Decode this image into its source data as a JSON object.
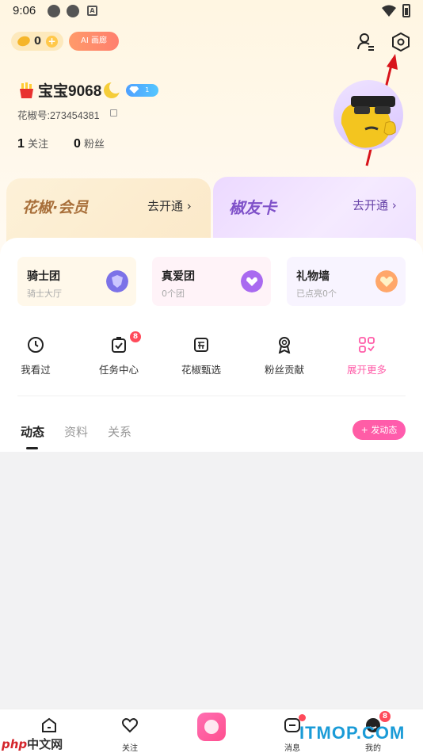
{
  "status_bar": {
    "time": "9:06"
  },
  "header": {
    "coin_count": "0",
    "ai_label": "AI 画廊"
  },
  "profile": {
    "name": "宝宝9068",
    "level": "1",
    "id_text": "花椒号:273454381",
    "following_count": "1",
    "following_label": "关注",
    "fans_count": "0",
    "fans_label": "粉丝"
  },
  "member_cards": [
    {
      "title": "花椒·会员",
      "action": "去开通 ›"
    },
    {
      "title": "椒友卡",
      "action": "去开通 ›"
    }
  ],
  "fan_cards": [
    {
      "title": "骑士团",
      "subtitle": "骑士大厅"
    },
    {
      "title": "真爱团",
      "subtitle": "0个团"
    },
    {
      "title": "礼物墙",
      "subtitle": "已点亮0个"
    }
  ],
  "quick_actions": [
    {
      "label": "我看过",
      "icon": "clock-icon"
    },
    {
      "label": "任务中心",
      "icon": "task-icon",
      "badge": "8"
    },
    {
      "label": "花椒甄选",
      "icon": "store-icon"
    },
    {
      "label": "粉丝贡献",
      "icon": "medal-icon"
    },
    {
      "label": "展开更多",
      "icon": "grid-icon"
    }
  ],
  "tabs": [
    "动态",
    "资料",
    "关系"
  ],
  "post_button": "+ 发动态",
  "bottom_nav": [
    {
      "label": "",
      "icon": "home-icon"
    },
    {
      "label": "关注",
      "icon": "heart-icon"
    },
    {
      "label": "",
      "icon": "camera-icon"
    },
    {
      "label": "消息",
      "icon": "message-icon"
    },
    {
      "label": "我的",
      "icon": "profile-icon",
      "badge": "8"
    }
  ],
  "watermarks": {
    "left_brand": "php",
    "left_text": "中文网",
    "right": "ITMOP.COM"
  },
  "colors": {
    "accent_pink": "#ff5da4",
    "vip_gold": "#a86f3a",
    "friend_purple": "#7f51c9",
    "badge_red": "#ff4a5a"
  }
}
